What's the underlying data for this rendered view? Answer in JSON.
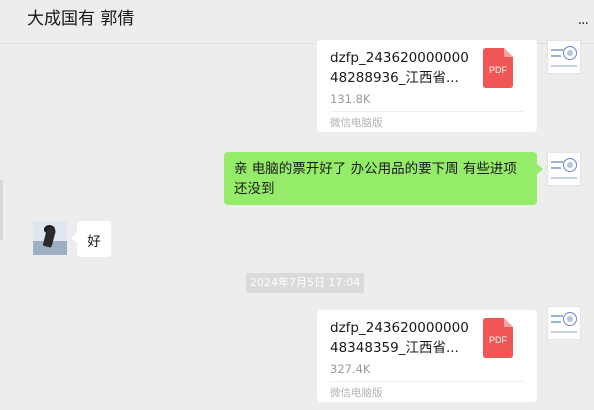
{
  "chat": {
    "title": "大成国有 郭倩",
    "more_label": "..."
  },
  "messages": [
    {
      "type": "file",
      "name": "dzfp_24362000000048288936_江西省...",
      "size": "131.8K",
      "source": "微信电脑版",
      "icon_label": "PDF"
    },
    {
      "type": "text",
      "text": "亲 电脑的票开好了 办公用品的要下周 有些进项还没到"
    },
    {
      "type": "text",
      "text": "好"
    },
    {
      "type": "timestamp",
      "text": "2024年7月5日 17:04"
    },
    {
      "type": "file",
      "name": "dzfp_24362000000048348359_江西省...",
      "size": "327.4K",
      "source": "微信电脑版",
      "icon_label": "PDF"
    }
  ],
  "colors": {
    "background": "#ededed",
    "sent_bubble": "#95ec69",
    "pdf_red": "#f05656"
  },
  "icons": [
    "pdf-file-icon",
    "more-options-icon"
  ]
}
